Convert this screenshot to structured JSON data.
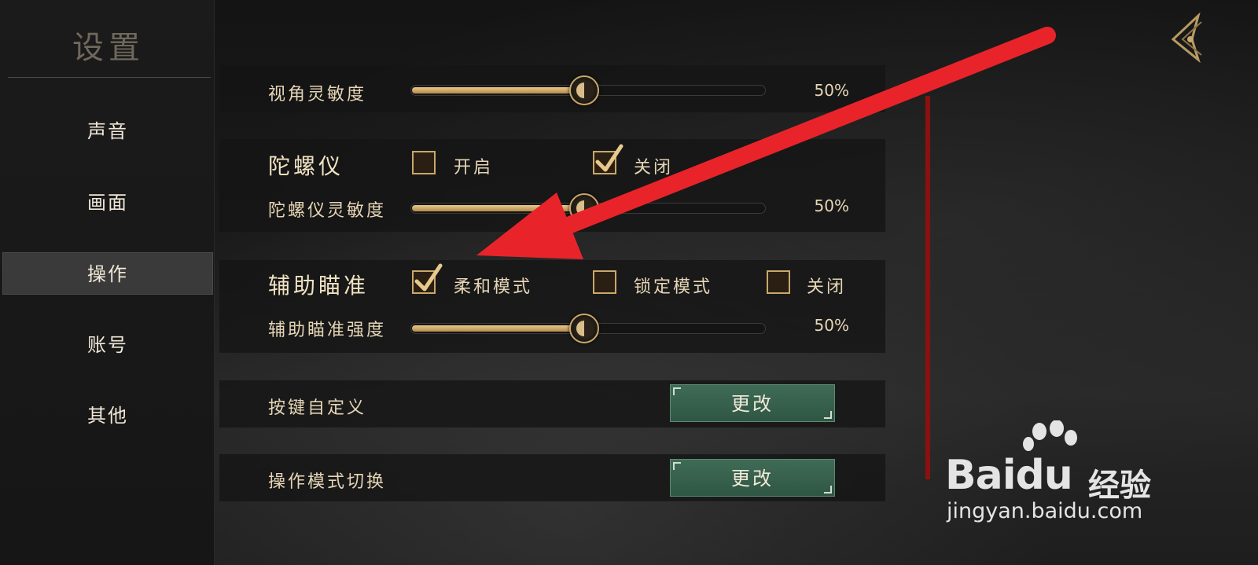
{
  "sidebar": {
    "title": "设置",
    "items": [
      {
        "label": "声音"
      },
      {
        "label": "画面"
      },
      {
        "label": "操作"
      },
      {
        "label": "账号"
      },
      {
        "label": "其他"
      }
    ],
    "active_item": "操作"
  },
  "settings": {
    "view_sensitivity": {
      "label": "视角灵敏度",
      "value": 0.5,
      "value_text": "50%"
    },
    "gyroscope": {
      "label": "陀螺仪",
      "options": [
        {
          "label": "开启",
          "checked": false
        },
        {
          "label": "关闭",
          "checked": true
        }
      ],
      "sensitivity": {
        "label": "陀螺仪灵敏度",
        "value": 0.5,
        "value_text": "50%"
      }
    },
    "aim_assist": {
      "label": "辅助瞄准",
      "options": [
        {
          "label": "柔和模式",
          "checked": true
        },
        {
          "label": "锁定模式",
          "checked": false
        },
        {
          "label": "关闭",
          "checked": false
        }
      ],
      "strength": {
        "label": "辅助瞄准强度",
        "value": 0.5,
        "value_text": "50%"
      }
    },
    "key_custom": {
      "label": "按键自定义",
      "button": "更改"
    },
    "mode_switch": {
      "label": "操作模式切换",
      "button": "更改"
    }
  },
  "watermark": {
    "brand": "Baidu",
    "brand_suffix": "经验",
    "url": "jingyan.baidu.com"
  },
  "colors": {
    "accent_gold": "#c9a86c",
    "button_green": "#3f6b56",
    "annotation_red": "#e8242a",
    "divider_red": "#8b1010"
  }
}
